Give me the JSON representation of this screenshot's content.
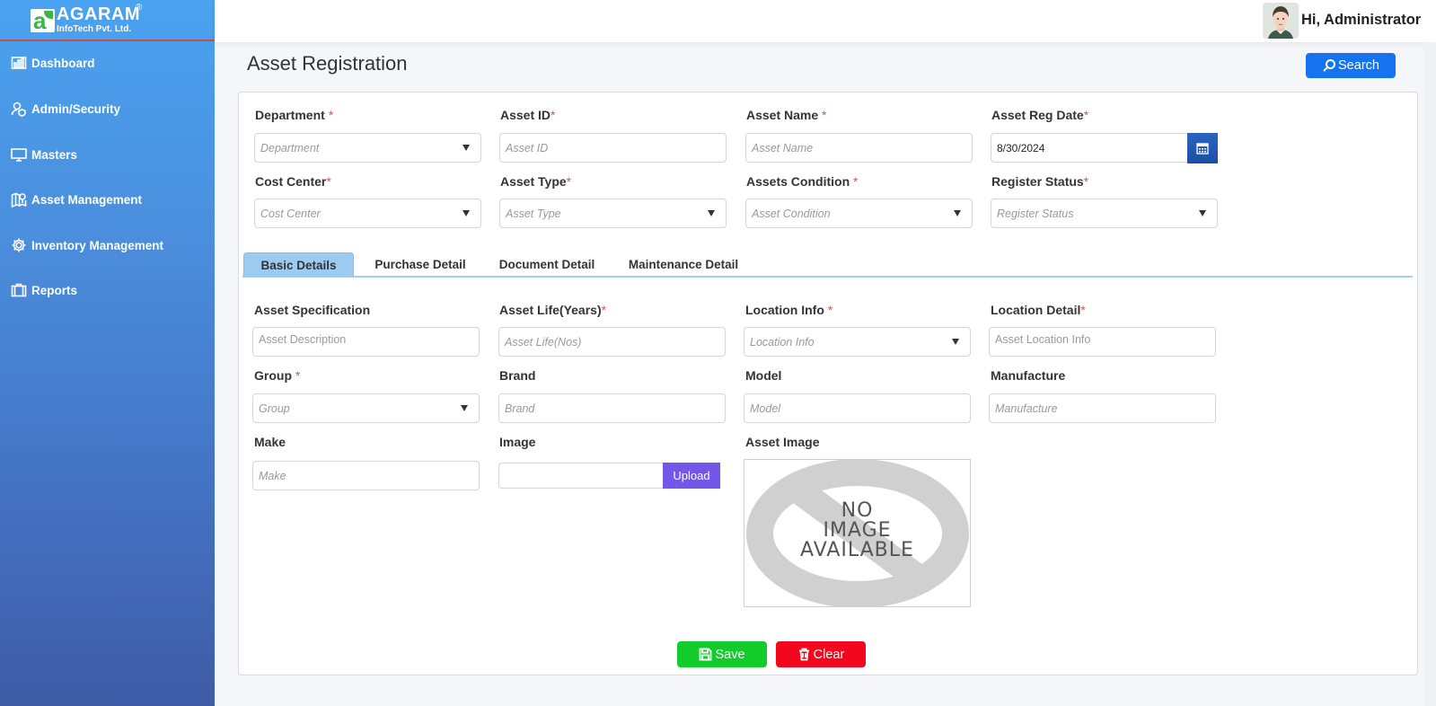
{
  "brand": {
    "name": "AGARAM",
    "registered": "®",
    "subtitle": "InfoTech Pvt. Ltd.",
    "logo_letter": "a"
  },
  "sidebar": {
    "items": [
      {
        "label": "Dashboard",
        "icon": "bar-chart-icon"
      },
      {
        "label": "Admin/Security",
        "icon": "user-shield-icon"
      },
      {
        "label": "Masters",
        "icon": "monitor-icon"
      },
      {
        "label": "Asset Management",
        "icon": "map-pin-icon"
      },
      {
        "label": "Inventory Management",
        "icon": "gear-icon"
      },
      {
        "label": "Reports",
        "icon": "briefcase-icon"
      }
    ]
  },
  "header": {
    "greeting": "Hi, Administrator"
  },
  "page": {
    "title": "Asset Registration",
    "search_label": "Search"
  },
  "top_form": {
    "department": {
      "label": "Department",
      "required": "*",
      "placeholder": "Department"
    },
    "asset_id": {
      "label": "Asset ID",
      "required": "*",
      "placeholder": "Asset ID"
    },
    "asset_name": {
      "label": "Asset Name",
      "required": "*",
      "placeholder": "Asset Name"
    },
    "asset_reg_date": {
      "label": "Asset Reg Date",
      "required": "*",
      "value": "8/30/2024"
    },
    "cost_center": {
      "label": "Cost Center",
      "required": "*",
      "placeholder": "Cost Center"
    },
    "asset_type": {
      "label": "Asset Type",
      "required": "*",
      "placeholder": "Asset Type"
    },
    "assets_condition": {
      "label": "Assets Condition",
      "required": "*",
      "placeholder": "Asset Condition"
    },
    "register_status": {
      "label": "Register Status",
      "required": "*",
      "placeholder": "Register Status"
    }
  },
  "tabs": [
    {
      "label": "Basic Details",
      "active": true
    },
    {
      "label": "Purchase Detail",
      "active": false
    },
    {
      "label": "Document Detail",
      "active": false
    },
    {
      "label": "Maintenance Detail",
      "active": false
    }
  ],
  "basic_details": {
    "asset_specification": {
      "label": "Asset Specification",
      "placeholder": "Asset Description"
    },
    "asset_life": {
      "label": "Asset Life(Years)",
      "required": "*",
      "placeholder": "Asset Life(Nos)"
    },
    "location_info": {
      "label": "Location Info",
      "required": "*",
      "placeholder": "Location Info"
    },
    "location_detail": {
      "label": "Location Detail",
      "required": "*",
      "placeholder": "Asset Location Info"
    },
    "group": {
      "label": "Group",
      "required": "*",
      "placeholder": "Group"
    },
    "brand": {
      "label": "Brand",
      "placeholder": "Brand"
    },
    "model": {
      "label": "Model",
      "placeholder": "Model"
    },
    "manufacture": {
      "label": "Manufacture",
      "placeholder": "Manufacture"
    },
    "make": {
      "label": "Make",
      "placeholder": "Make"
    },
    "image": {
      "label": "Image",
      "upload_label": "Upload"
    },
    "asset_image": {
      "label": "Asset Image",
      "no_image_lines": [
        "NO",
        "IMAGE",
        "AVAILABLE"
      ]
    }
  },
  "actions": {
    "save_label": "Save",
    "clear_label": "Clear"
  },
  "colors": {
    "sidebar_top": "#4aa3f0",
    "sidebar_bottom": "#3f5ba6",
    "search_button": "#1673f0",
    "upload_button": "#7357e8",
    "save_button": "#12cc2c",
    "clear_button": "#f2071e",
    "active_tab": "#9ccbf1",
    "required_mark": "#d9534f"
  }
}
